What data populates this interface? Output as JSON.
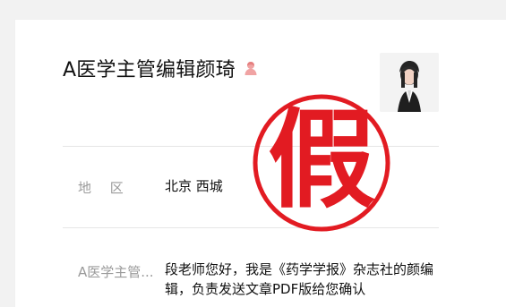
{
  "profile": {
    "name": "A医学主管编辑颜琦",
    "person_icon": "female-person-icon",
    "avatar_icon": "profile-photo"
  },
  "fields": {
    "region_label": "地 区",
    "region_value": "北京 西城",
    "message_label": "A医学主管...",
    "message_value": "段老师您好，我是《药学学报》杂志社的颜编辑，负责发送文章PDF版给您确认"
  },
  "stamp": {
    "text": "假",
    "color": "#e21b22"
  },
  "colors": {
    "label": "#9a9a9a",
    "text": "#111111",
    "divider": "#e6e6e6",
    "background": "#f2f2f2",
    "card": "#ffffff"
  }
}
